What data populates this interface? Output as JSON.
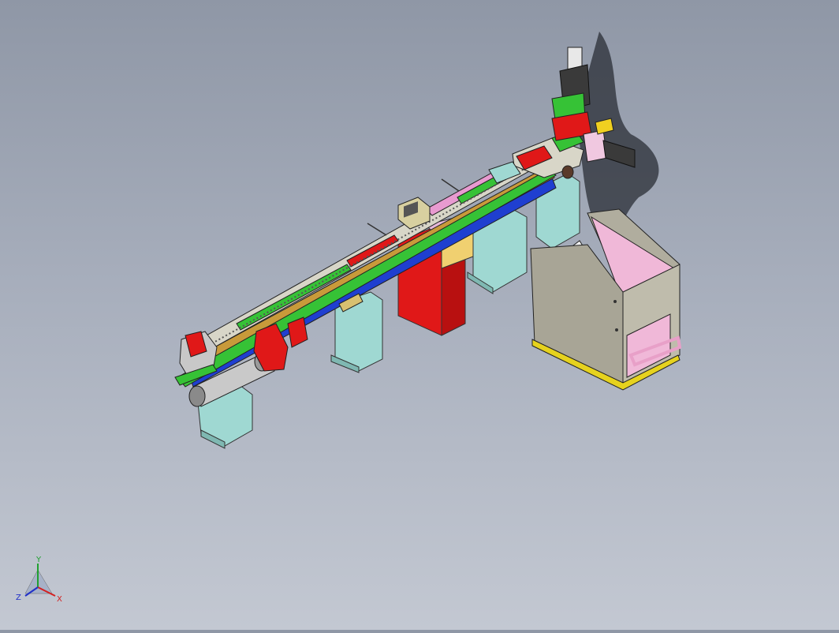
{
  "viewport": {
    "background_top": "#8f97a6",
    "background_bottom": "#c3c8d2"
  },
  "triad": {
    "x_label": "X",
    "y_label": "Y",
    "z_label": "Z",
    "x_color": "#d42020",
    "y_color": "#20a030",
    "z_color": "#2030c8"
  },
  "model": {
    "part_colors": {
      "pedestal": "#9fd8d2",
      "red_block": "#e01818",
      "beam_green": "#36c236",
      "beam_orange": "#c89a3a",
      "beam_blue": "#1f3fd0",
      "beam_pink": "#e89ad0",
      "bin_wall": "#a8a596",
      "bin_pink": "#f0b8d8",
      "bin_base": "#e6d21e",
      "cylinder": "#c9c9c9",
      "motor": "#3a3a3a"
    }
  }
}
